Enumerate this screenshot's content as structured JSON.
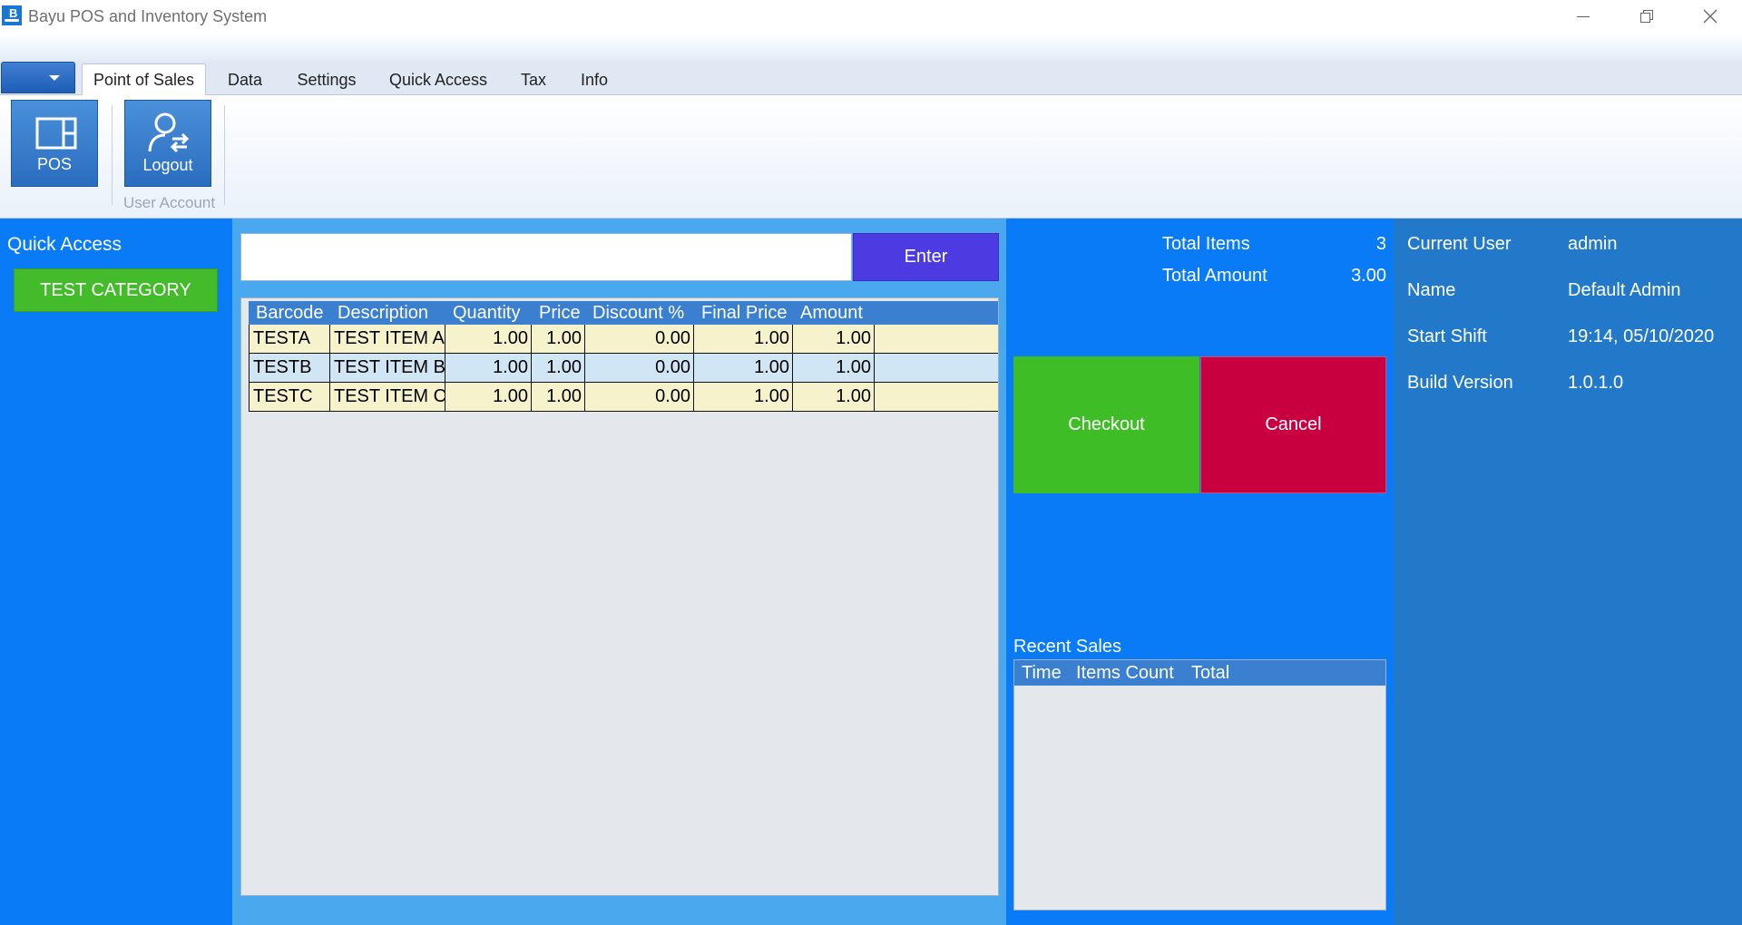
{
  "window": {
    "title": "Bayu POS and Inventory System",
    "icon_letter": "B"
  },
  "ribbon": {
    "tabs": [
      {
        "label": "Point of Sales",
        "active": true
      },
      {
        "label": "Data"
      },
      {
        "label": "Settings"
      },
      {
        "label": "Quick Access"
      },
      {
        "label": "Tax"
      },
      {
        "label": "Info"
      }
    ],
    "buttons": {
      "pos": {
        "label": "POS",
        "icon": "pos-window-icon"
      },
      "logout": {
        "label": "Logout",
        "icon": "user-switch-icon"
      }
    },
    "group_label": "User Account"
  },
  "quick_access": {
    "title": "Quick Access",
    "categories": [
      "TEST CATEGORY"
    ]
  },
  "entry": {
    "value": "",
    "placeholder": "",
    "enter_label": "Enter"
  },
  "items_grid": {
    "columns": [
      "Barcode",
      "Description",
      "Quantity",
      "Price",
      "Discount %",
      "Final Price",
      "Amount"
    ],
    "rows": [
      {
        "barcode": "TESTA",
        "description": "TEST ITEM A",
        "quantity": "1.00",
        "price": "1.00",
        "discount": "0.00",
        "final_price": "1.00",
        "amount": "1.00"
      },
      {
        "barcode": "TESTB",
        "description": "TEST ITEM B",
        "quantity": "1.00",
        "price": "1.00",
        "discount": "0.00",
        "final_price": "1.00",
        "amount": "1.00"
      },
      {
        "barcode": "TESTC",
        "description": "TEST ITEM C",
        "quantity": "1.00",
        "price": "1.00",
        "discount": "0.00",
        "final_price": "1.00",
        "amount": "1.00"
      }
    ]
  },
  "totals": {
    "items_label": "Total Items",
    "items_value": "3",
    "amount_label": "Total Amount",
    "amount_value": "3.00"
  },
  "actions": {
    "checkout": "Checkout",
    "cancel": "Cancel"
  },
  "recent_sales": {
    "title": "Recent Sales",
    "columns": [
      "Time",
      "Items Count",
      "Total"
    ],
    "rows": []
  },
  "session": [
    {
      "label": "Current User",
      "value": "admin"
    },
    {
      "label": "Name",
      "value": "Default Admin"
    },
    {
      "label": "Start Shift",
      "value": "19:14, 05/10/2020"
    },
    {
      "label": "Build Version",
      "value": "1.0.1.0"
    }
  ],
  "colors": {
    "panel_blue": "#0a7bf7",
    "center_blue": "#4aa9ee",
    "info_blue": "#2379c9",
    "grid_header": "#3b7fd0",
    "row_yellow": "#f6f2cc",
    "row_blue": "#d0e6f5",
    "category_green": "#44bb2a",
    "checkout_green": "#3fbd27",
    "cancel_red": "#c8003f",
    "enter_purple": "#4c3be0"
  }
}
